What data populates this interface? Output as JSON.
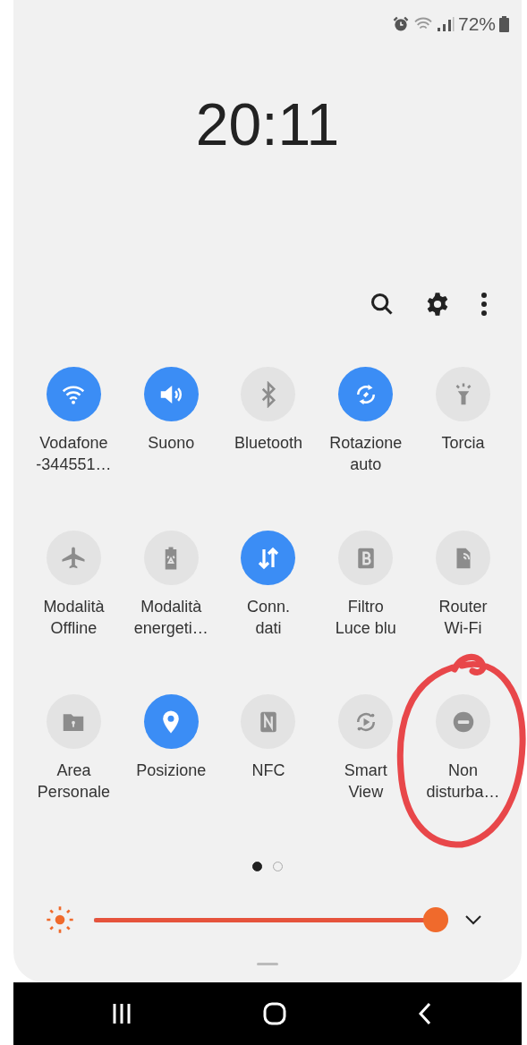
{
  "status_bar": {
    "battery": "72%"
  },
  "clock": {
    "time": "20:11"
  },
  "tiles": [
    {
      "label": "Vodafone\n-344551…",
      "on": true
    },
    {
      "label": "Suono",
      "on": true
    },
    {
      "label": "Bluetooth",
      "on": false
    },
    {
      "label": "Rotazione\nauto",
      "on": true
    },
    {
      "label": "Torcia",
      "on": false
    },
    {
      "label": "Modalità\nOffline",
      "on": false
    },
    {
      "label": "Modalità\nenergeti…",
      "on": false
    },
    {
      "label": "Conn.\ndati",
      "on": true
    },
    {
      "label": "Filtro\nLuce blu",
      "on": false
    },
    {
      "label": "Router\nWi-Fi",
      "on": false
    },
    {
      "label": "Area\nPersonale",
      "on": false
    },
    {
      "label": "Posizione",
      "on": true
    },
    {
      "label": "NFC",
      "on": false
    },
    {
      "label": "Smart\nView",
      "on": false
    },
    {
      "label": "Non\ndisturba…",
      "on": false,
      "circled": true
    }
  ],
  "pages": [
    {
      "selected": true
    },
    {
      "selected": false
    }
  ],
  "brightness": {
    "level": 1
  }
}
